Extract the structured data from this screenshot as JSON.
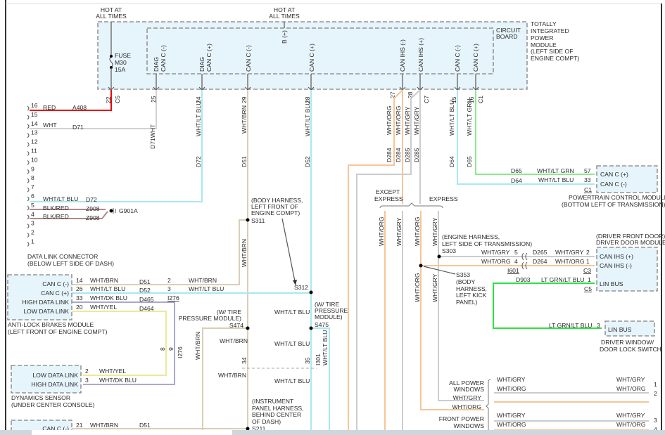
{
  "t": {
    "hot_at": "HOT AT",
    "all_times": "ALL TIMES",
    "fuse": "FUSE",
    "m30": "M30",
    "amp15": "15A",
    "b_plus": "B (+)",
    "diag": "DIAG",
    "can_c_minus": "CAN C (-)",
    "can_c_plus": "CAN C (+)",
    "can_ihs_minus": "CAN IHS (-)",
    "can_ihs_plus": "CAN IHS (+)",
    "circuit": "CIRCUIT",
    "board": "BOARD",
    "tipm1": "TOTALLY",
    "tipm2": "INTEGRATED",
    "tipm3": "POWER",
    "tipm4": "MODULE",
    "tipm5": "(LEFT SIDE OF",
    "tipm6": "ENGINE COMPT)",
    "p22": "22",
    "c5": "C5",
    "p25": "25",
    "p24": "24",
    "p29": "29",
    "p28": "28",
    "p27": "27",
    "c7": "C7",
    "p15": "15",
    "p16": "16",
    "c1": "C1",
    "d71wht": "D71WHT",
    "wht_ltblu": "WHT/LT BLU",
    "wht_brn": "WHT/BRN",
    "wht_org": "WHT/ORG",
    "wht_gry": "WHT/GRY",
    "wht_ltgrn": "WHT/LT GRN",
    "wht_dkblu": "WHT/DK BLU",
    "wht_yel": "WHT/YEL",
    "red": "RED",
    "wht": "WHT",
    "blk_red": "BLK/RED",
    "ltgrn_ltblu": "LT GRN/LT BLU",
    "a408": "A408",
    "d71": "D71",
    "d72": "D72",
    "d51": "D51",
    "d52": "D52",
    "d284": "D284",
    "d285": "D285",
    "d64": "D64",
    "d65": "D65",
    "z908": "Z908",
    "d465": "D465",
    "d464": "D464",
    "d265": "D265",
    "d264": "D264",
    "d903": "D903",
    "g901a": "G901A",
    "dlc_pins": [
      "16",
      "15",
      "14",
      "13",
      "12",
      "11",
      "10",
      "9",
      "8",
      "7",
      "6",
      "5",
      "4",
      "3",
      "2",
      "1"
    ],
    "dlc1": "DATA LINK CONNECTOR",
    "dlc2": "(BELOW LEFT SIDE OF DASH)",
    "s311_1": "(BODY HARNESS,",
    "s311_2": "LEFT FRONT OF",
    "s311_3": "ENGINE COMPT)",
    "s311": "S311",
    "s312": "S312",
    "abs_can_minus": "CAN C (-)",
    "abs_can_plus": "CAN C (+)",
    "high_dl": "HIGH DATA LINK",
    "low_dl": "LOW DATA LINK",
    "n14": "14",
    "n26": "26",
    "n33": "33",
    "n20": "20",
    "n2": "2",
    "n3": "3",
    "n8": "8",
    "n9": "9",
    "i276": "I276",
    "abs1": "ANTI-LOCK BRAKES MODULE",
    "abs2": "(LEFT FRONT OF ENGINE COMPT)",
    "dyn1": "DYNAMICS SENSOR",
    "dyn2": "(UNDER CENTER CONSOLE)",
    "n21": "21",
    "tp1": "(W/ TIRE",
    "tp2": "PRESSURE MODULE)",
    "tp_r2": "PRESSURE",
    "tp_r3": "MODULE)",
    "s474": "S474",
    "s475": "S475",
    "n34": "34",
    "n35": "35",
    "i301": "I301",
    "ip1": "(INSTRUMENT",
    "ip2": "PANEL HARNESS,",
    "ip3": "BEHIND CENTER",
    "ip4": "OF DASH)",
    "s211": "S211",
    "except": "EXCEPT",
    "express": "EXPRESS",
    "pcm_can_plus": "CAN C (+)",
    "pcm_can_minus": "CAN C (-)",
    "n57": "57",
    "pcm1": "POWERTRAIN CONTROL MODULE",
    "pcm2": "(BOTTOM LEFT OF TRANSMISSION)",
    "eh1": "(ENGINE HARNESS,",
    "eh2": "LEFT SIDE OF TRANSMISSION)",
    "s303": "S303",
    "s353": "S353",
    "bh1": "(BODY",
    "bh2": "HARNESS,",
    "bh3": "LEFT KICK",
    "bh4": "PANEL)",
    "n5": "5",
    "n4": "4",
    "n1": "1",
    "i601": "I601",
    "c3": "C3",
    "ddm1": "(DRIVER FRONT DOOR)",
    "ddm2": "DRIVER DOOR MODULE",
    "lin_bus": "LIN BUS",
    "dws1": "DRIVER WINDOW/",
    "dws2": "DOOR LOCK SWITCH",
    "apw1": "ALL POWER",
    "windows": "WINDOWS",
    "fpw1": "FRONT POWER",
    "r1": "1",
    "r2": "2",
    "r3": "3",
    "r4": "4"
  }
}
